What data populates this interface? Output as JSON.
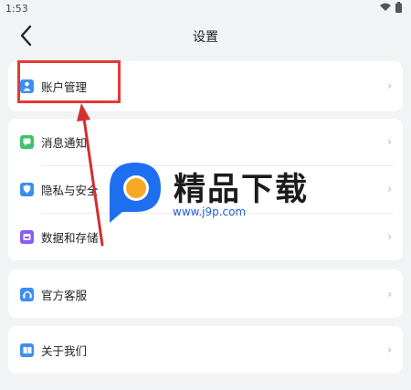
{
  "status": {
    "time": "1:53"
  },
  "header": {
    "title": "设置"
  },
  "groups": [
    {
      "items": [
        {
          "label": "账户管理",
          "icon": "user-icon",
          "color": "#3d8ef2"
        }
      ]
    },
    {
      "items": [
        {
          "label": "消息通知",
          "icon": "message-icon",
          "color": "#3ec26b"
        },
        {
          "label": "隐私与安全",
          "icon": "shield-icon",
          "color": "#3d8ef2"
        },
        {
          "label": "数据和存储",
          "icon": "storage-icon",
          "color": "#8b5cf6"
        }
      ]
    },
    {
      "items": [
        {
          "label": "官方客服",
          "icon": "headset-icon",
          "color": "#3d8ef2"
        }
      ]
    },
    {
      "items": [
        {
          "label": "关于我们",
          "icon": "book-icon",
          "color": "#3d8ef2"
        }
      ]
    }
  ],
  "watermark": {
    "title": "精品下载",
    "url": "www.j9p.com"
  }
}
